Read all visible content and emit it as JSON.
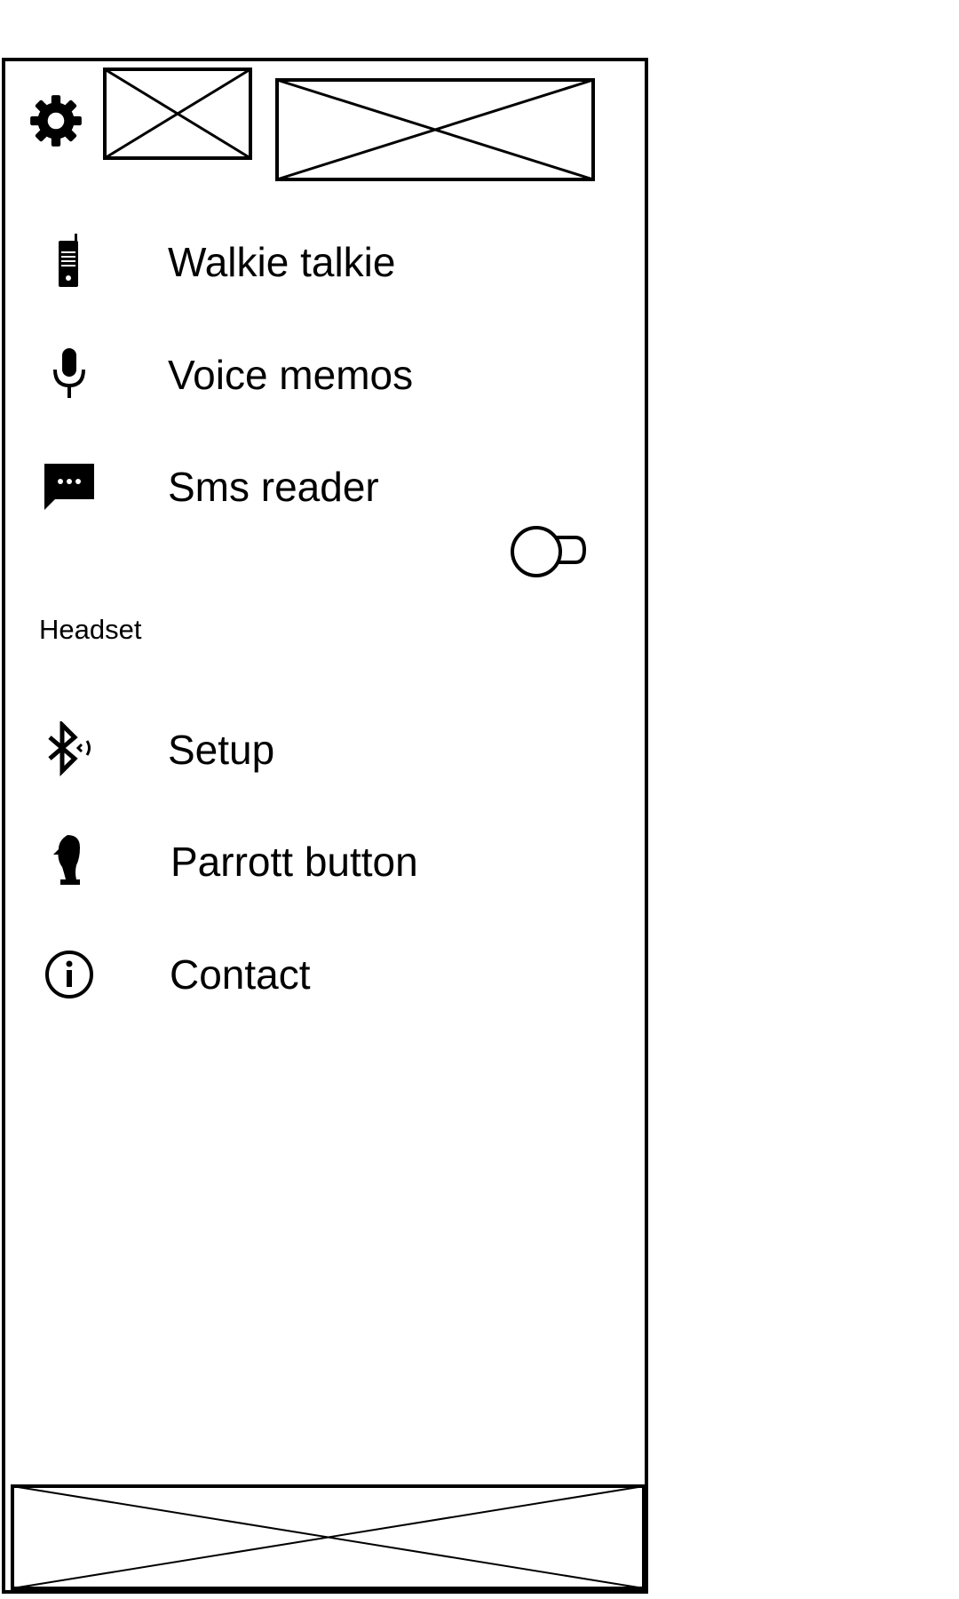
{
  "header": {
    "settings_icon": "gear-icon",
    "logo_placeholder": "image-placeholder",
    "title_placeholder": "image-placeholder"
  },
  "menu": {
    "items": [
      {
        "label": "Walkie talkie",
        "icon": "walkie-talkie-icon"
      },
      {
        "label": "Voice memos",
        "icon": "microphone-icon"
      },
      {
        "label": "Sms reader",
        "icon": "sms-message-icon",
        "toggle": {
          "on": false
        }
      }
    ]
  },
  "headset": {
    "section_label": "Headset",
    "items": [
      {
        "label": "Setup",
        "icon": "bluetooth-icon"
      },
      {
        "label": "Parrott button",
        "icon": "parrot-icon"
      },
      {
        "label": "Contact",
        "icon": "info-icon"
      }
    ]
  },
  "footer": {
    "banner_placeholder": "image-placeholder"
  }
}
